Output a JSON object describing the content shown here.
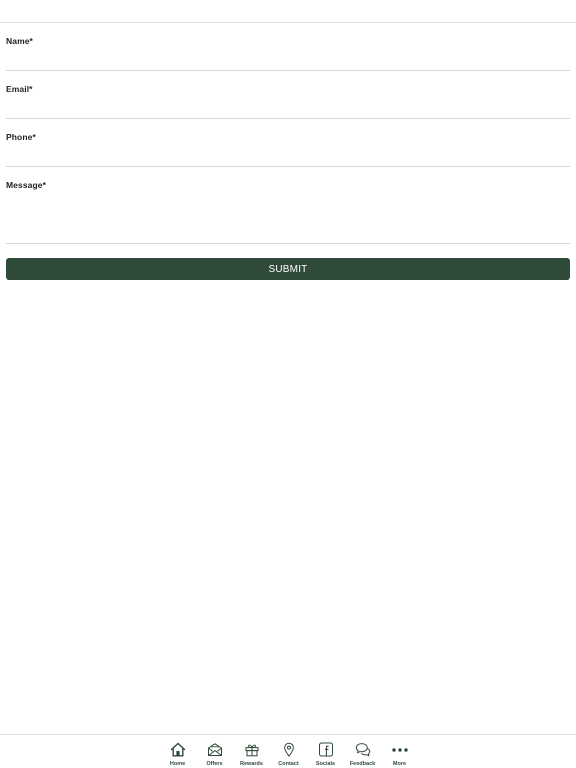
{
  "form": {
    "name_label": "Name*",
    "name_value": "",
    "email_label": "Email*",
    "email_value": "",
    "phone_label": "Phone*",
    "phone_value": "",
    "message_label": "Message*",
    "message_value": "",
    "submit_label": "SUBMIT"
  },
  "nav": {
    "items": [
      {
        "label": "Home",
        "icon": "home-icon"
      },
      {
        "label": "Offers",
        "icon": "offers-icon"
      },
      {
        "label": "Rewards",
        "icon": "gift-icon"
      },
      {
        "label": "Contact",
        "icon": "location-pin-icon"
      },
      {
        "label": "Socials",
        "icon": "facebook-icon"
      },
      {
        "label": "Feedback",
        "icon": "chat-bubbles-icon"
      },
      {
        "label": "More",
        "icon": "more-dots-icon"
      }
    ]
  },
  "colors": {
    "accent": "#2f4a39",
    "divider": "#d4d4d4",
    "background": "#ffffff"
  }
}
